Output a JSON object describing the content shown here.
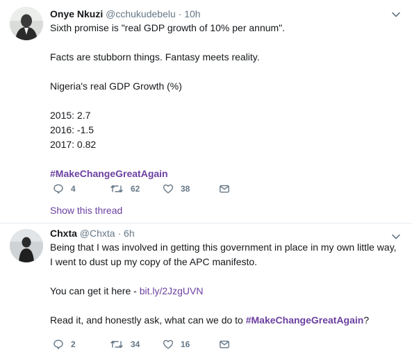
{
  "tweets": [
    {
      "name": "Onye Nkuzi",
      "handle": "@cchukudebelu",
      "separator": "·",
      "time": "10h",
      "lines": [
        "Sixth promise is \"real GDP growth of 10% per annum\".",
        "",
        "Facts are stubborn things. Fantasy meets reality.",
        "",
        "Nigeria's real GDP Growth (%)",
        "",
        "2015: 2.7",
        "2016: -1.5",
        "2017: 0.82"
      ],
      "hashtag": "#MakeChangeGreatAgain",
      "replies": "4",
      "retweets": "62",
      "likes": "38",
      "show_thread": "Show this thread"
    },
    {
      "name": "Chxta",
      "handle": "@Chxta",
      "separator": "·",
      "time": "6h",
      "line1": "Being that I was involved in getting this government in place in my own little way,",
      "line2": "I went to dust up my copy of the APC manifesto.",
      "link_prefix": "You can get it here - ",
      "link": "bit.ly/2JzgUVN",
      "ask_prefix": "Read it, and honestly ask, what can we do to ",
      "hashtag": "#MakeChangeGreatAgain",
      "ask_suffix": "?",
      "replies": "2",
      "retweets": "34",
      "likes": "16"
    }
  ],
  "colors": {
    "accent": "#6b3fa0",
    "muted": "#657786",
    "text": "#14171a",
    "divider": "#e6ecf0"
  },
  "icons": [
    "chevron-down-icon",
    "reply-icon",
    "retweet-icon",
    "like-icon",
    "direct-message-icon"
  ]
}
